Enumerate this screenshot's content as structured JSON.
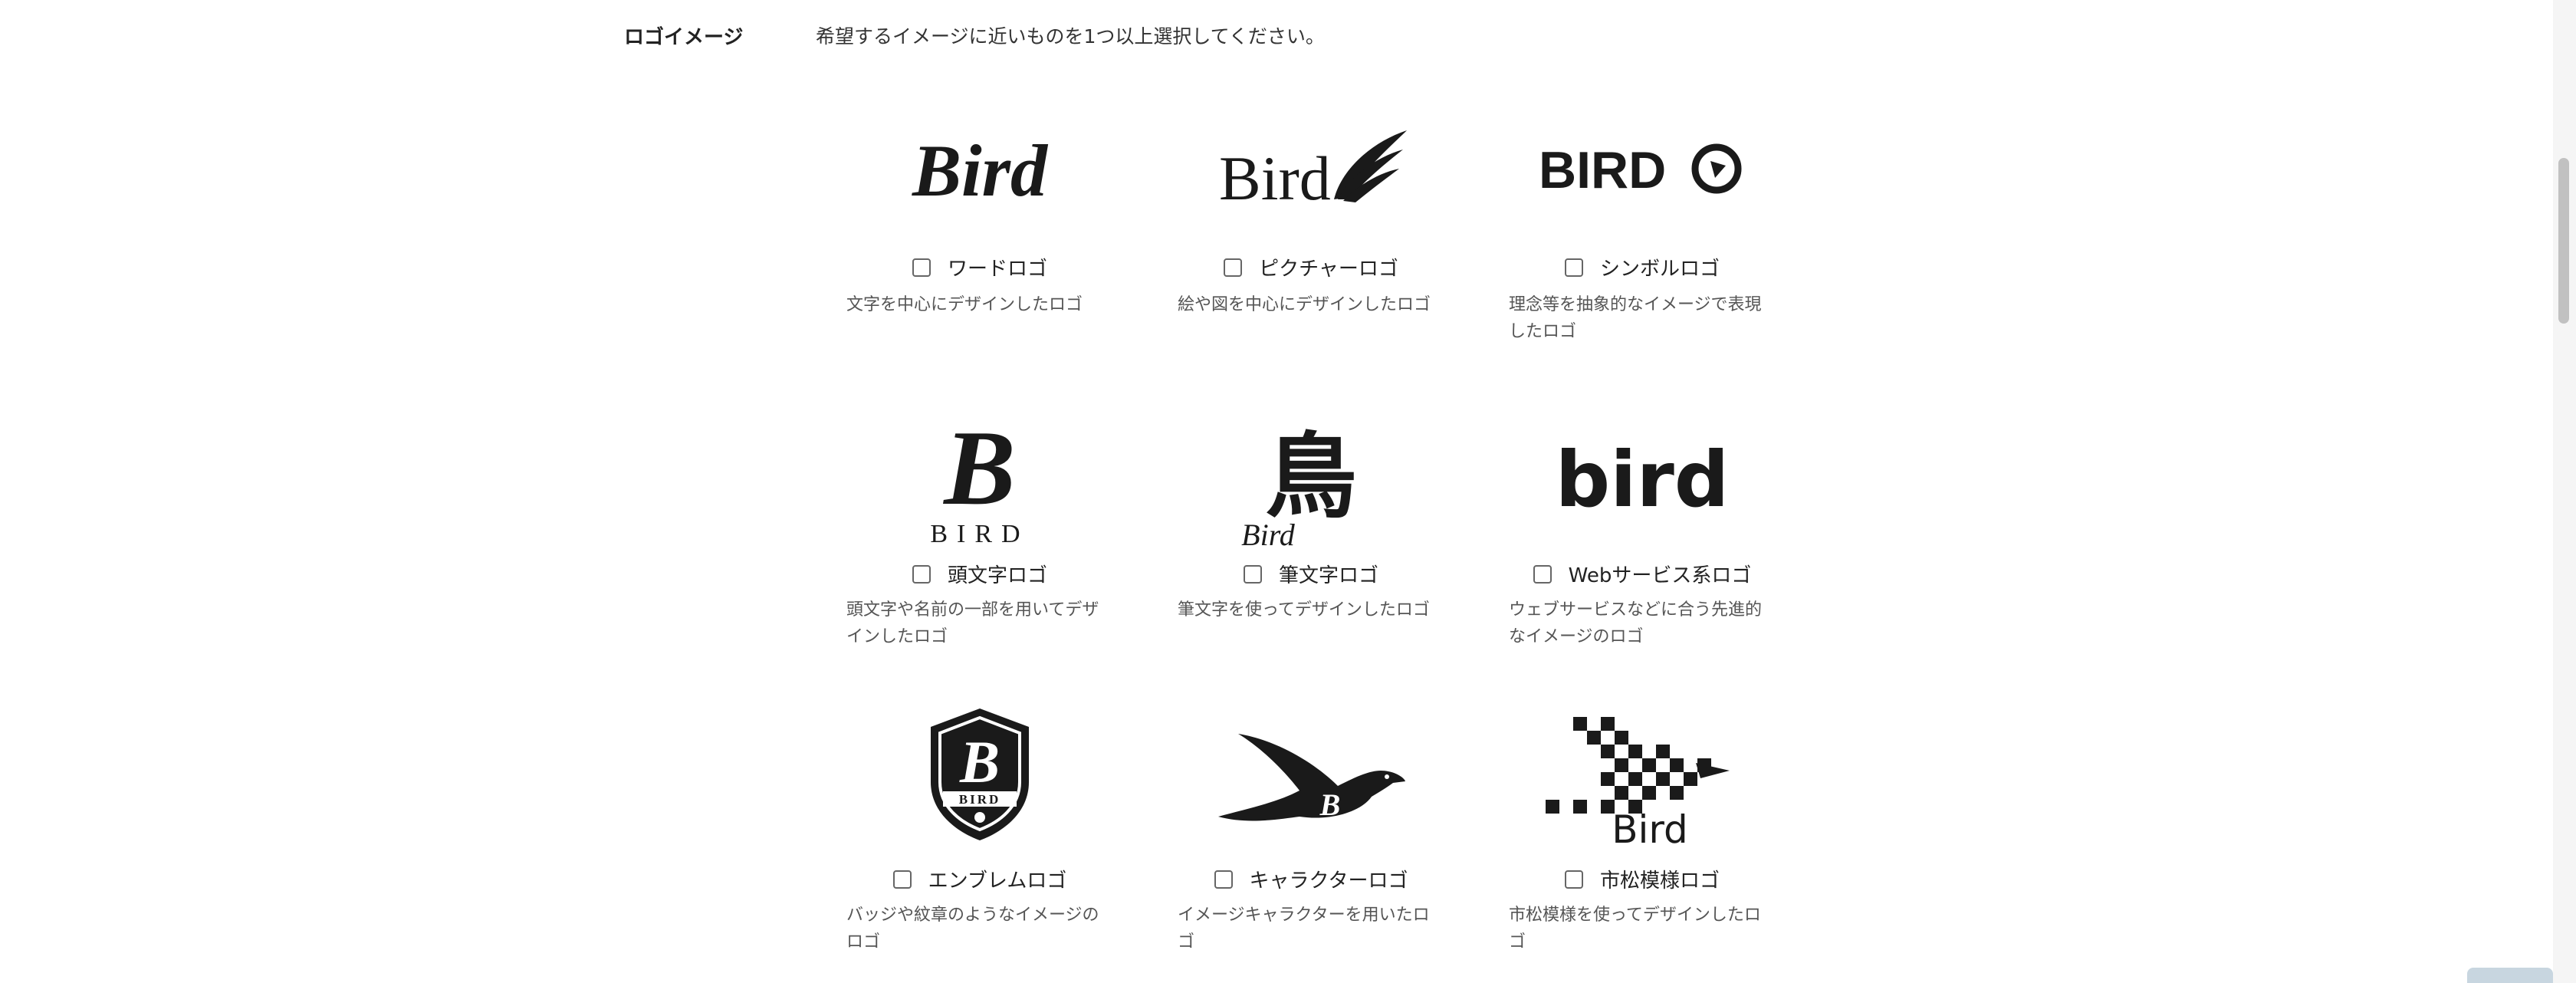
{
  "section": {
    "label": "ロゴイメージ",
    "instruction": "希望するイメージに近いものを1つ以上選択してください。"
  },
  "options": [
    {
      "label": "ワードロゴ",
      "description": "文字を中心にデザインしたロゴ",
      "icon": "word-logo-image",
      "logo_text": "Bird",
      "checked": false
    },
    {
      "label": "ピクチャーロゴ",
      "description": "絵や図を中心にデザインしたロゴ",
      "icon": "picture-logo-image",
      "logo_text": "Bird",
      "checked": false
    },
    {
      "label": "シンボルロゴ",
      "description": "理念等を抽象的なイメージで表現したロゴ",
      "icon": "symbol-logo-image",
      "logo_text": "BIRD",
      "checked": false
    },
    {
      "label": "頭文字ロゴ",
      "description": "頭文字や名前の一部を用いてデザインしたロゴ",
      "icon": "initial-logo-image",
      "logo_text": "BIRD",
      "logo_initial": "B",
      "checked": false
    },
    {
      "label": "筆文字ロゴ",
      "description": "筆文字を使ってデザインしたロゴ",
      "icon": "brush-logo-image",
      "logo_text": "Bird",
      "logo_kanji": "鳥",
      "checked": false
    },
    {
      "label": "Webサービス系ロゴ",
      "description": "ウェブサービスなどに合う先進的なイメージのロゴ",
      "icon": "web-service-logo-image",
      "logo_text": "bird",
      "checked": false
    },
    {
      "label": "エンブレムロゴ",
      "description": "バッジや紋章のようなイメージのロゴ",
      "icon": "emblem-logo-image",
      "logo_text": "BIRD",
      "logo_initial": "B",
      "checked": false
    },
    {
      "label": "キャラクターロゴ",
      "description": "イメージキャラクターを用いたロゴ",
      "icon": "character-logo-image",
      "logo_initial": "B",
      "checked": false
    },
    {
      "label": "市松模様ロゴ",
      "description": "市松模様を使ってデザインしたロゴ",
      "icon": "checkered-logo-image",
      "logo_text": "Bird",
      "checked": false
    }
  ]
}
